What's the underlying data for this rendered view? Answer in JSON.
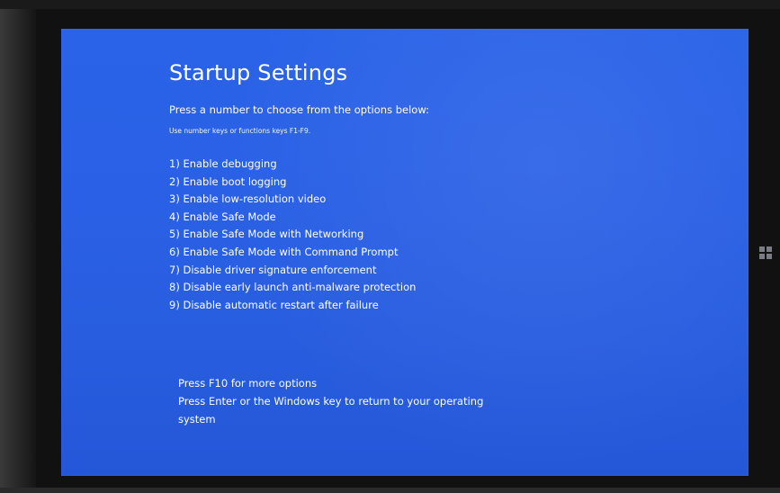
{
  "screen": {
    "title": "Startup Settings",
    "subtitle": "Press a number to choose from the options below:",
    "hint": "Use number keys or functions keys F1-F9.",
    "options": [
      "1) Enable debugging",
      "2) Enable boot logging",
      "3) Enable low-resolution video",
      "4) Enable Safe Mode",
      "5) Enable Safe Mode with Networking",
      "6) Enable Safe Mode with Command Prompt",
      "7) Disable driver signature enforcement",
      "8) Disable early launch anti-malware protection",
      "9) Disable automatic restart after failure"
    ],
    "footer": {
      "more_options": "Press F10 for more options",
      "return_line1": "Press Enter or the Windows key to return to your operating",
      "return_line2": "system"
    }
  },
  "colors": {
    "background": "#2a60e5",
    "text": "#ffffff",
    "bezel": "#111111"
  },
  "icons": {
    "hardware_button": "windows-logo-icon"
  }
}
